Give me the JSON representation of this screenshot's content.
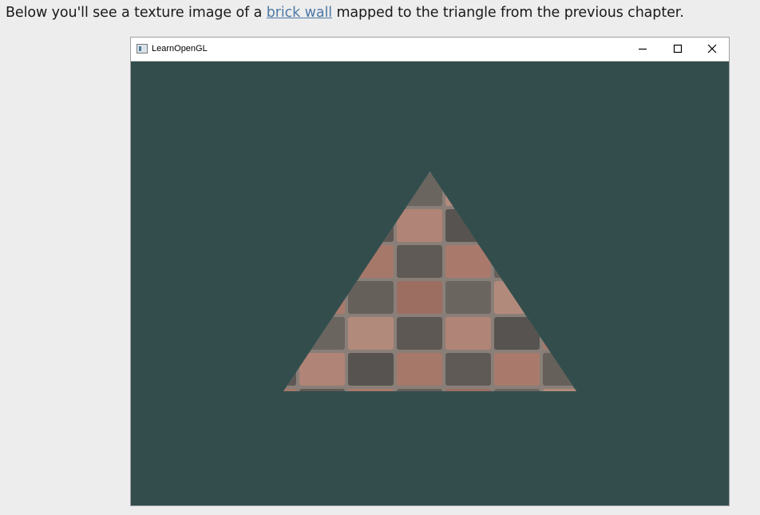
{
  "intro": {
    "before": "Below you'll see a texture image of a ",
    "link": "brick wall",
    "after": " mapped to the triangle from the previous chapter."
  },
  "window": {
    "title": "LearnOpenGL",
    "clear_color": "#334d4d",
    "icons": {
      "app": "window-icon",
      "minimize": "minimize-icon",
      "maximize": "maximize-icon",
      "close": "close-icon"
    }
  },
  "colors": {
    "page_background": "#ededed",
    "link": "#4d79a6",
    "brick_light": "#a97a6c",
    "brick_dark": "#5e5854",
    "mortar": "#8a7f78"
  }
}
